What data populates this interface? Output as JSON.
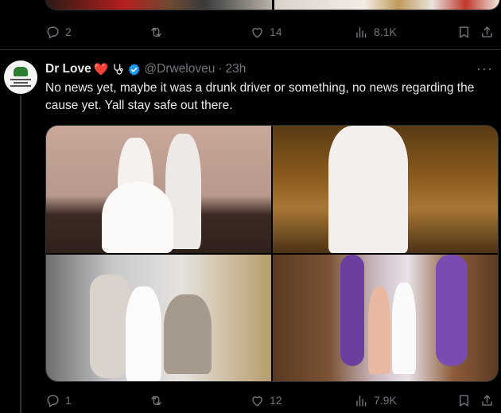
{
  "previous_tweet": {
    "reply_count": "2",
    "like_count": "14",
    "view_count": "8.1K"
  },
  "tweet": {
    "display_name": "Dr Love",
    "name_emoji": "❤️",
    "handle": "@Drweloveu",
    "separator": "·",
    "time": "23h",
    "more": "···",
    "text": "No news yet, maybe it was a drunk driver or something, no news regarding the cause yet. Yall stay safe out there.",
    "reply_count": "1",
    "like_count": "12",
    "view_count": "7.9K",
    "verified_color": "#1d9bf0"
  },
  "media": [
    {
      "name": "photo-couple-white-gown-studio"
    },
    {
      "name": "photo-white-gown-bokeh-lights"
    },
    {
      "name": "photo-couple-seated-silver-throne"
    },
    {
      "name": "photo-couple-purple-balloon-arch"
    }
  ]
}
